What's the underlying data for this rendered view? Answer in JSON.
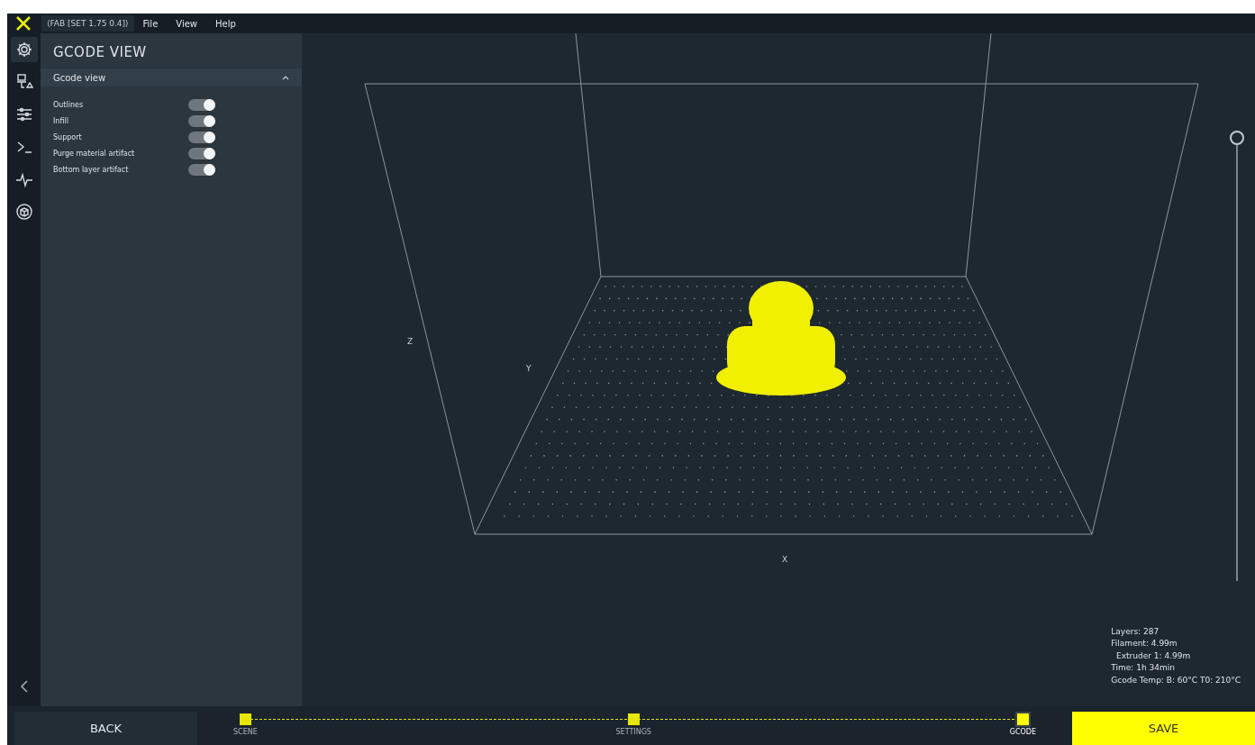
{
  "menubar": {
    "profile": "⟨FAB [SET 1.75 0.4]⟩",
    "menus": [
      "File",
      "View",
      "Help"
    ]
  },
  "rail": {
    "icons": [
      {
        "kind": "gear",
        "selected": true
      },
      {
        "kind": "printer",
        "selected": false
      },
      {
        "kind": "sliders",
        "selected": false
      },
      {
        "kind": "terminal",
        "selected": false
      },
      {
        "kind": "pulse",
        "selected": false
      },
      {
        "kind": "cube",
        "selected": false
      }
    ]
  },
  "panel": {
    "title": "GCODE VIEW",
    "section": {
      "label": "Gcode view",
      "expanded": true,
      "toggles": [
        {
          "label": "Outlines",
          "on": true
        },
        {
          "label": "Infill",
          "on": true
        },
        {
          "label": "Support",
          "on": true
        },
        {
          "label": "Purge material artifact",
          "on": true
        },
        {
          "label": "Bottom layer artifact",
          "on": true
        }
      ]
    }
  },
  "viewport": {
    "axes": {
      "z": "Z",
      "y": "Y",
      "x": "X"
    },
    "layer_slider": {
      "level": 1
    },
    "stats": [
      "Layers: 287",
      "Filament: 4.99m",
      "  Extruder 1: 4.99m",
      "Time: 1h 34min",
      "Gcode Temp: B: 60°C T0: 210°C"
    ]
  },
  "footer": {
    "back": "BACK",
    "steps": [
      {
        "label": "SCENE",
        "selected": false
      },
      {
        "label": "SETTINGS",
        "selected": false
      },
      {
        "label": "GCODE",
        "selected": true
      }
    ],
    "save": "SAVE"
  }
}
